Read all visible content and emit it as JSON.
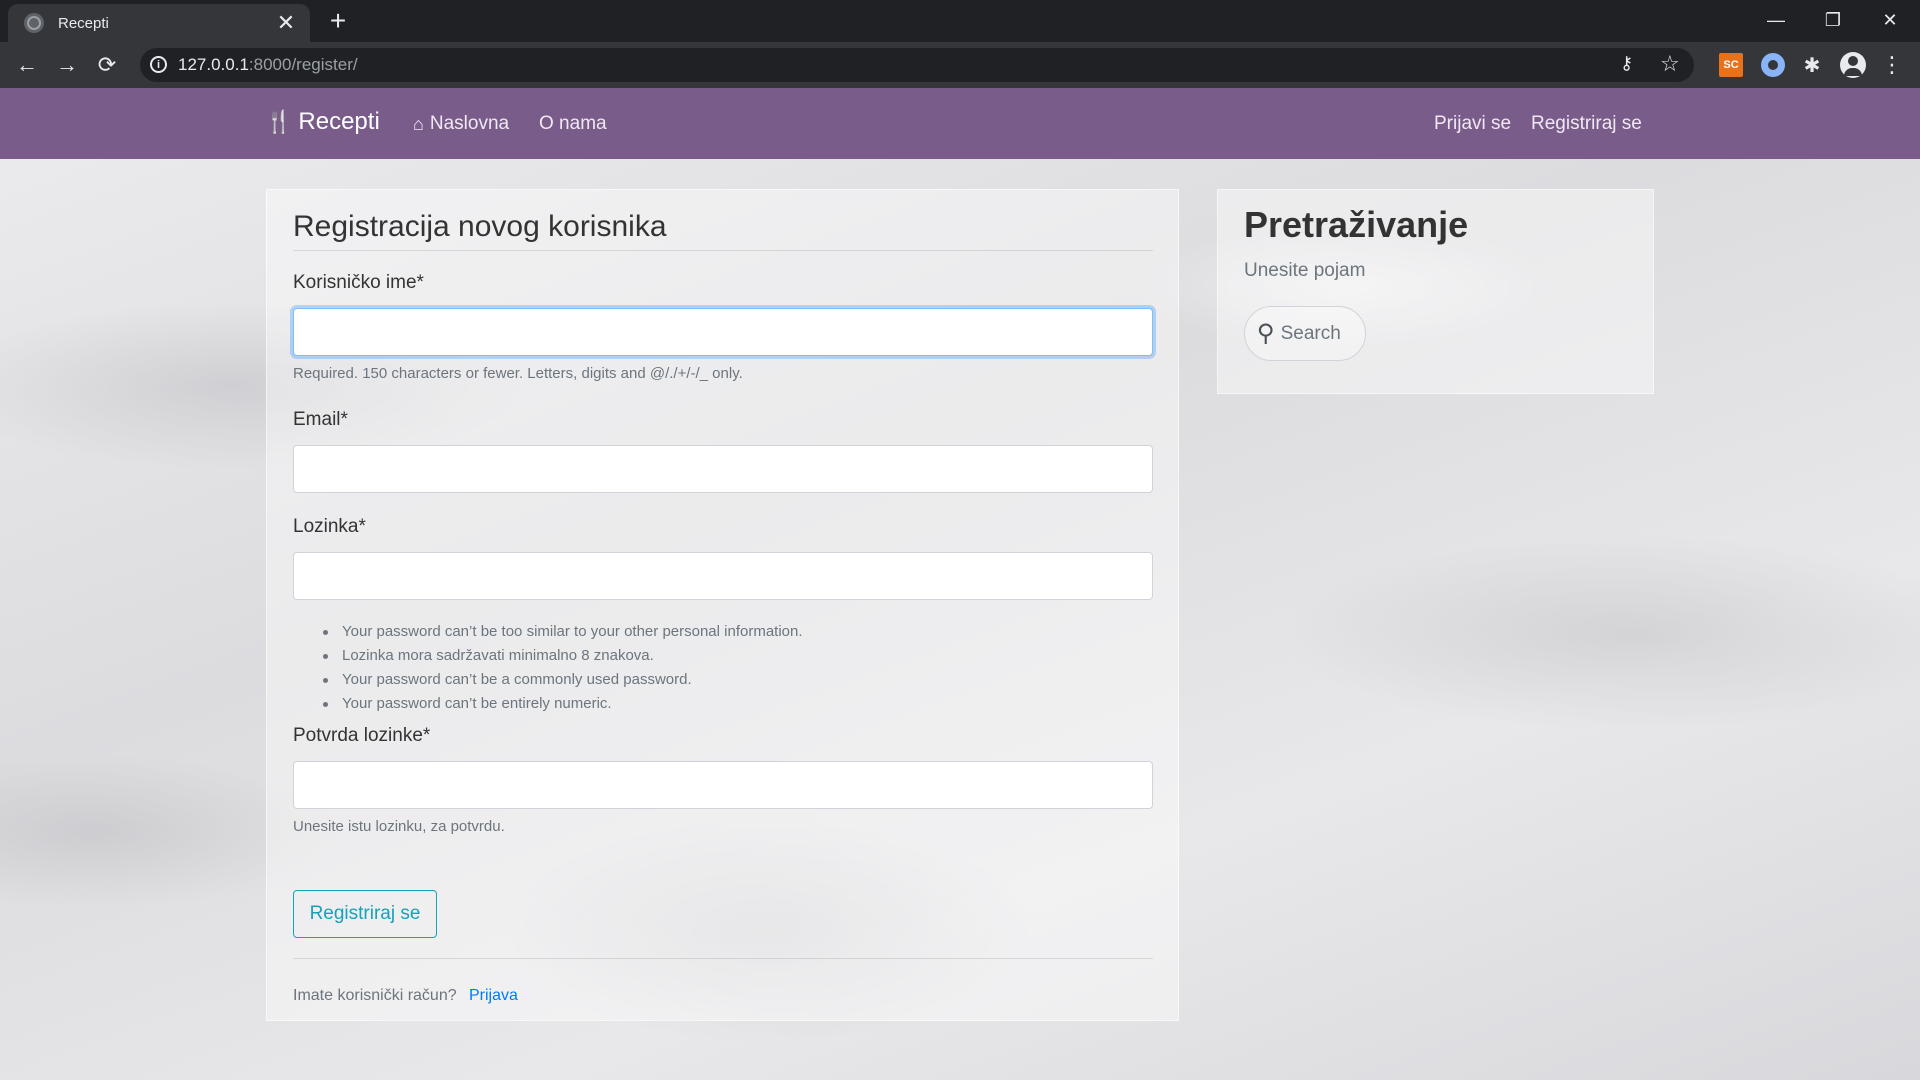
{
  "browser": {
    "tab_title": "Recepti",
    "tab_close": "✕",
    "new_tab": "+",
    "url_host": "127.0.0.1",
    "url_rest": ":8000/register/",
    "info_glyph": "i",
    "ext_sc_label": "SC",
    "window_controls": {
      "minimize": "—",
      "restore": "❐",
      "close": "✕"
    },
    "nav_glyphs": {
      "back": "←",
      "forward": "→",
      "reload": "⟳"
    },
    "icons": {
      "key": "⚷",
      "star": "☆",
      "puzzle": "✱",
      "menu": "⋮"
    }
  },
  "navbar": {
    "brand": "Recepti",
    "brand_icon": "cutlery-icon",
    "brand_glyph": "🍴",
    "home_glyph": "⌂",
    "links": [
      {
        "label": "Naslovna",
        "icon": "home-icon"
      },
      {
        "label": "O nama"
      },
      {
        "label": "Prijavi se"
      },
      {
        "label": "Registriraj se"
      }
    ],
    "color": "#7a5c8a"
  },
  "form": {
    "title": "Registracija novog korisnika",
    "username_label": "Korisničko ime*",
    "username_help": "Required. 150 characters or fewer. Letters, digits and @/./+/-/_ only.",
    "email_label": "Email*",
    "password_label": "Lozinka*",
    "password_help": [
      "Your password can’t be too similar to your other personal information.",
      "Lozinka mora sadržavati minimalno 8 znakova.",
      "Your password can’t be a commonly used password.",
      "Your password can’t be entirely numeric."
    ],
    "confirm_label": "Potvrda lozinke*",
    "confirm_help": "Unesite istu lozinku, za potvrdu.",
    "submit_label": "Registriraj se",
    "footer_text": "Imate korisnički račun?",
    "footer_link": "Prijava"
  },
  "sidebar": {
    "title": "Pretraživanje",
    "subtitle": "Unesite pojam",
    "search_placeholder": "Search",
    "search_glyph": "⚲"
  }
}
